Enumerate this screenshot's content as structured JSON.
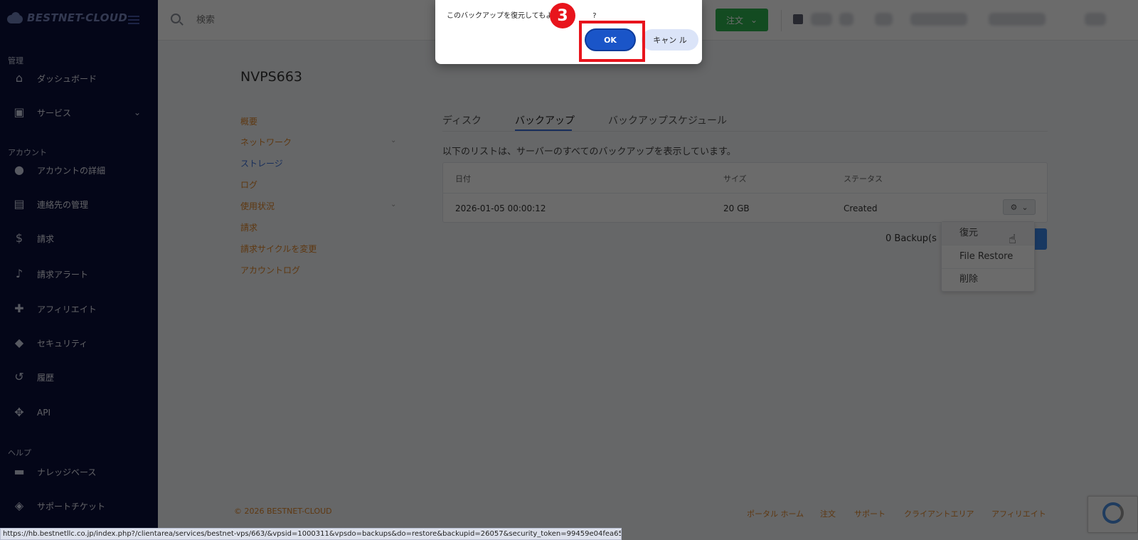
{
  "brand": {
    "logo_text": "BESTNET-CLOUD"
  },
  "sidebar": {
    "sections": [
      "管理",
      "アカウント",
      "ヘルプ"
    ],
    "items": [
      {
        "label": "ダッシュボード",
        "icon": "home-icon"
      },
      {
        "label": "サービス",
        "icon": "service-icon"
      },
      {
        "label": "アカウントの詳細",
        "icon": "user-icon"
      },
      {
        "label": "連絡先の管理",
        "icon": "contacts-icon"
      },
      {
        "label": "請求",
        "icon": "dollar-icon"
      },
      {
        "label": "請求アラート",
        "icon": "bell-icon"
      },
      {
        "label": "アフィリエイト",
        "icon": "affiliate-icon"
      },
      {
        "label": "セキュリティ",
        "icon": "shield-icon"
      },
      {
        "label": "履歴",
        "icon": "history-icon"
      },
      {
        "label": "API",
        "icon": "api-icon"
      },
      {
        "label": "ナレッジベース",
        "icon": "book-icon"
      },
      {
        "label": "サポートチケット",
        "icon": "ticket-icon"
      }
    ]
  },
  "topbar": {
    "search_placeholder": "検索",
    "order_label": "注文"
  },
  "page": {
    "title": "NVPS663",
    "subnav": [
      "概要",
      "ネットワーク",
      "ストレージ",
      "ログ",
      "使用状況",
      "請求",
      "請求サイクルを変更",
      "アカウントログ"
    ],
    "tabs": [
      "ディスク",
      "バックアップ",
      "バックアップスケジュール"
    ],
    "active_tab": "バックアップ",
    "description": "以下のリストは、サーバーのすべてのバックアップを表示しています。",
    "table": {
      "headers": [
        "日付",
        "サイズ",
        "ステータス"
      ],
      "rows": [
        {
          "date": "2026-01-05 00:00:12",
          "size": "20 GB",
          "status": "Created"
        }
      ]
    },
    "count_text": "0 Backup(s",
    "dropdown": [
      "復元",
      "File Restore",
      "削除"
    ]
  },
  "footer": {
    "copyright": "© 2026 BESTNET-CLOUD",
    "links": [
      "ポータル ホーム",
      "注文",
      "サポート",
      "クライアントエリア",
      "アフィリエイト"
    ]
  },
  "statusbar": {
    "url": "https://hb.bestnetllc.co.jp/index.php?/clientarea/services/bestnet-vps/663/&vpsid=1000311&vpsdo=backups&do=restore&backupid=26057&security_token=99459e04fea65ea8bf1cfd842e8927ae"
  },
  "dialog": {
    "message": "このバックアップを復元してもよろし",
    "message_tail": "?",
    "ok_label": "OK",
    "cancel_label": "キャン ル",
    "step_number": "3"
  },
  "colors": {
    "sidebar_bg": "#0b0f3a",
    "accent_orange": "#e0862a",
    "accent_blue": "#3a6fd8",
    "order_green": "#2fb350",
    "highlight_red": "#e8141c"
  }
}
